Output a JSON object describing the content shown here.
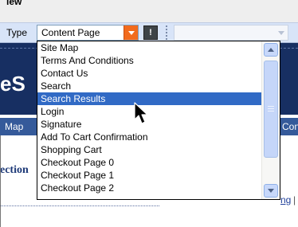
{
  "window": {
    "menu_fragment": "iew"
  },
  "toolbar": {
    "type_label": "Type",
    "type_select": {
      "value": "Content Page",
      "arrow_icon": "dropdown-arrow-icon"
    },
    "warning_button": {
      "icon": "exclamation-icon",
      "label": "!"
    }
  },
  "page": {
    "brand_fragment": "eS",
    "nav_left": "Map",
    "nav_right": "Cont",
    "section_fragment": "ection",
    "bottom_link": "ng",
    "bottom_separator": "|"
  },
  "dropdown": {
    "items": [
      "Site Map",
      "Terms And Conditions",
      "Contact Us",
      "Search",
      "Search Results",
      "Login",
      "Signature",
      "Add To Cart Confirmation",
      "Shopping Cart",
      "Checkout Page 0",
      "Checkout Page 1",
      "Checkout Page 2"
    ],
    "selected_index": 4,
    "scrollbar": {
      "up_icon": "scroll-up-arrow-icon",
      "down_icon": "scroll-down-arrow-icon"
    }
  },
  "cursor": {
    "icon": "mouse-pointer-icon"
  },
  "colors": {
    "selection": "#316ac5",
    "header_band": "#172f62",
    "select_button": "#f26b1d"
  }
}
